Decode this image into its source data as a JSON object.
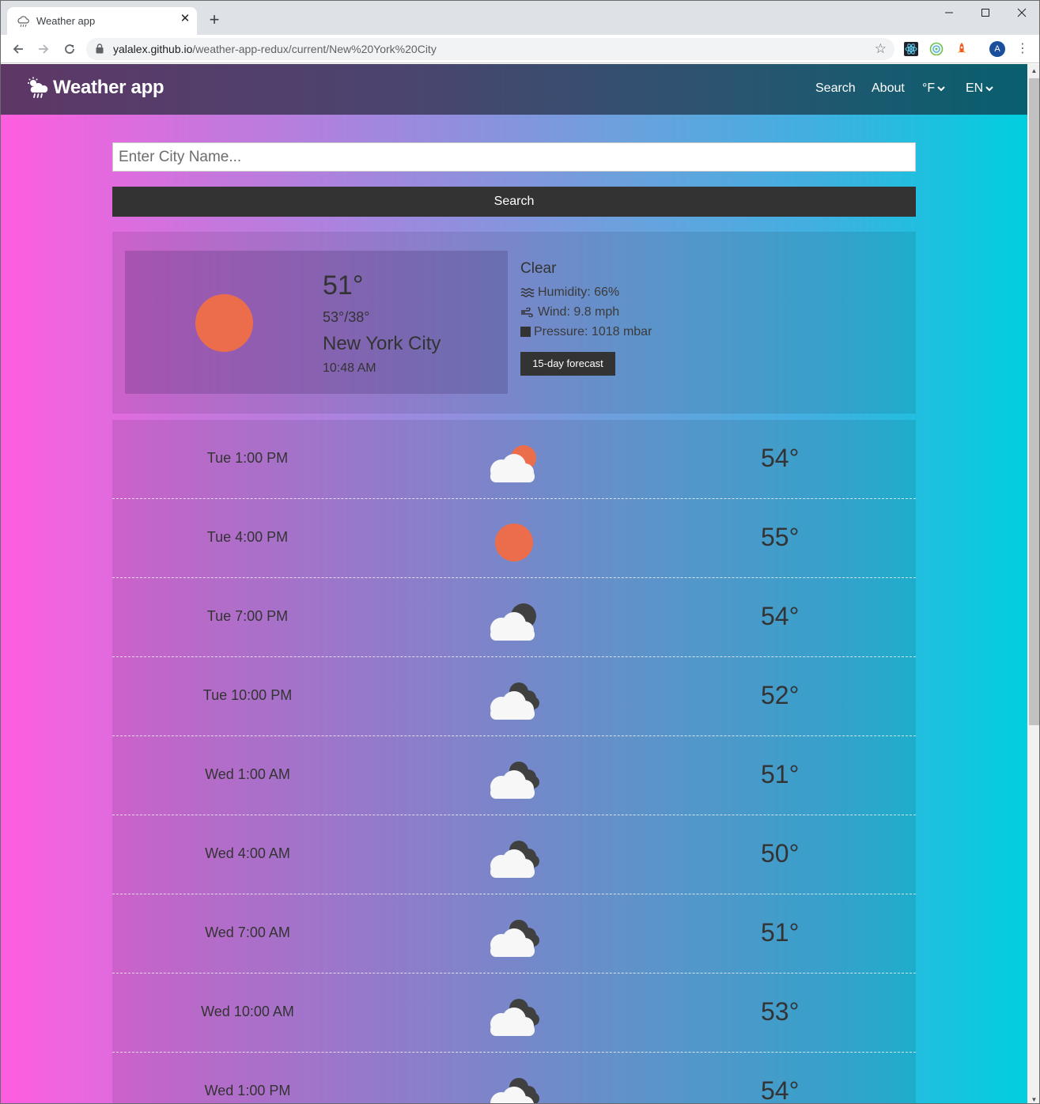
{
  "browser": {
    "tab_title": "Weather app",
    "url_host": "yalalex.github.io",
    "url_path": "/weather-app-redux/current/New%20York%20City",
    "profile_initial": "A"
  },
  "navbar": {
    "brand": "Weather app",
    "links": {
      "search": "Search",
      "about": "About",
      "units": "°F",
      "lang": "EN"
    }
  },
  "search": {
    "placeholder": "Enter City Name...",
    "value": "",
    "button_label": "Search"
  },
  "current": {
    "icon": "sun-icon",
    "temp": "51°",
    "hilo": "53°/38°",
    "city": "New York City",
    "time": "10:48 AM",
    "description": "Clear",
    "humidity": "Humidity: 66%",
    "wind": "Wind: 9.8 mph",
    "pressure": "Pressure: 1018 mbar",
    "forecast_button": "15-day forecast"
  },
  "hourly": [
    {
      "time": "Tue 1:00 PM",
      "icon": "partly-cloudy-day-icon",
      "temp": "54°"
    },
    {
      "time": "Tue 4:00 PM",
      "icon": "sun-icon",
      "temp": "55°"
    },
    {
      "time": "Tue 7:00 PM",
      "icon": "partly-cloudy-night-icon",
      "temp": "54°"
    },
    {
      "time": "Tue 10:00 PM",
      "icon": "cloudy-icon",
      "temp": "52°"
    },
    {
      "time": "Wed 1:00 AM",
      "icon": "cloudy-icon",
      "temp": "51°"
    },
    {
      "time": "Wed 4:00 AM",
      "icon": "cloudy-icon",
      "temp": "50°"
    },
    {
      "time": "Wed 7:00 AM",
      "icon": "cloudy-icon",
      "temp": "51°"
    },
    {
      "time": "Wed 10:00 AM",
      "icon": "cloudy-icon",
      "temp": "53°"
    },
    {
      "time": "Wed 1:00 PM",
      "icon": "cloudy-icon",
      "temp": "54°"
    }
  ],
  "colors": {
    "sun": "#ec6d4b",
    "dark_cloud": "#404040",
    "button_bg": "#333333"
  }
}
